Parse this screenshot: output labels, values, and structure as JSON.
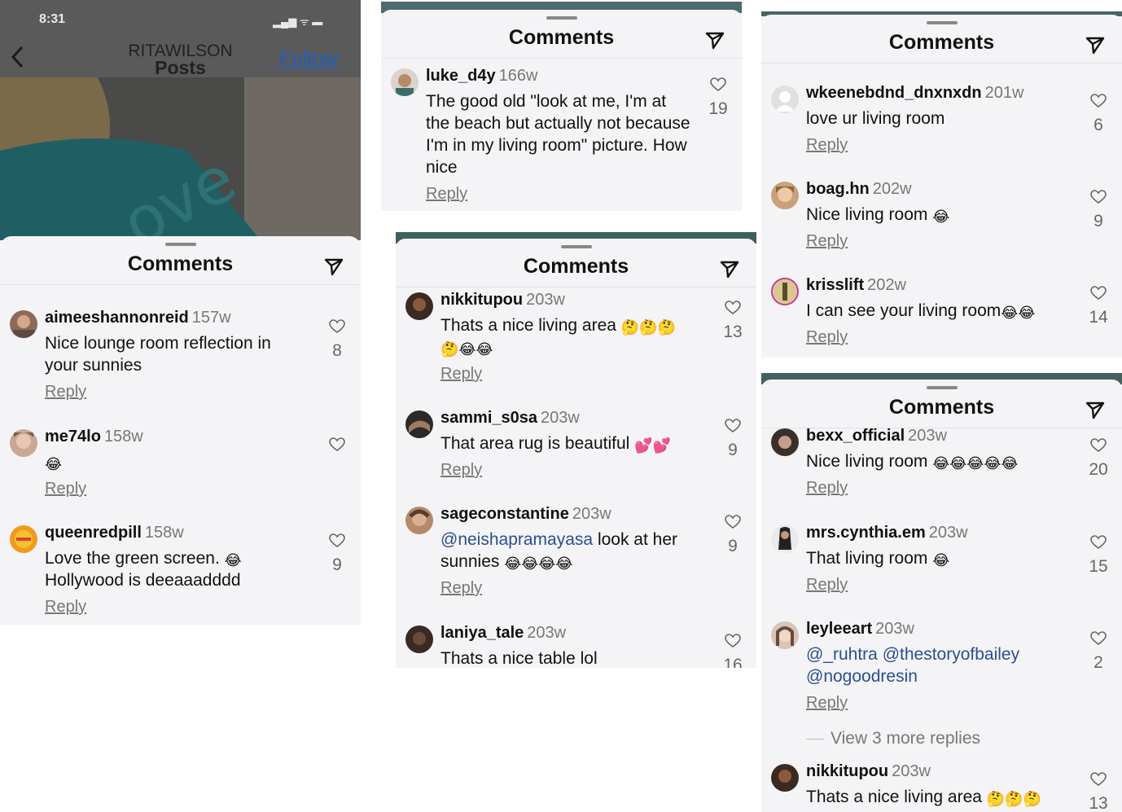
{
  "colors": {
    "mention": "#2a4f8f",
    "follow": "#1d5fbf",
    "sheet_bg": "#f4f4f6"
  },
  "panel1": {
    "status_time": "8:31",
    "account_name": "RITAWILSON",
    "page_title": "Posts",
    "follow_label": "Follow",
    "photo_text": "ove",
    "sheet_title": "Comments",
    "comments": [
      {
        "username": "aimeeshannonreid",
        "age": "157w",
        "text": "Nice lounge room reflection in your sunnies",
        "reply": "Reply",
        "likes": "8"
      },
      {
        "username": "me74lo",
        "age": "158w",
        "emoji": "😂",
        "reply": "Reply",
        "likes": ""
      },
      {
        "username": "queenredpill",
        "age": "158w",
        "text": "Love the green screen.",
        "emoji": "😂",
        "text2": "Hollywood is deeaaadddd",
        "reply": "Reply",
        "likes": "9"
      }
    ]
  },
  "panel2": {
    "sheet_title": "Comments",
    "comment": {
      "username": "luke_d4y",
      "age": "166w",
      "text": "The good old \"look at me, I'm at the beach but actually not because I'm in my living room\" picture. How nice",
      "reply": "Reply",
      "likes": "19"
    }
  },
  "panel3": {
    "sheet_title": "Comments",
    "comments": [
      {
        "username": "nikkitupou",
        "age": "203w",
        "text": "Thats a nice living area",
        "emoji": "🤔🤔🤔",
        "emoji2": "🤔😂😂",
        "reply": "Reply",
        "likes": "13"
      },
      {
        "username": "sammi_s0sa",
        "age": "203w",
        "text": "That area rug is beautiful",
        "emoji": "💕💕",
        "reply": "Reply",
        "likes": "9"
      },
      {
        "username": "sageconstantine",
        "age": "203w",
        "mention": "@neishapramayasa",
        "text": "look at her",
        "text2": "sunnies",
        "emoji": "😂😂😂😂",
        "reply": "Reply",
        "likes": "9"
      },
      {
        "username": "laniya_tale",
        "age": "203w",
        "text": "Thats a nice table lol",
        "likes": "16"
      }
    ]
  },
  "panel4": {
    "sheet_title": "Comments",
    "comments": [
      {
        "username": "wkeenebdnd_dnxnxdn",
        "age": "201w",
        "text": "love ur living room",
        "reply": "Reply",
        "likes": "6"
      },
      {
        "username": "boag.hn",
        "age": "202w",
        "text": "Nice living room",
        "emoji": "😂",
        "reply": "Reply",
        "likes": "9"
      },
      {
        "username": "krisslift",
        "age": "202w",
        "text": "I can see your living room",
        "emoji": "😂😂",
        "reply": "Reply",
        "likes": "14"
      }
    ]
  },
  "panel5": {
    "sheet_title": "Comments",
    "view_more": "View 3 more replies",
    "comments": [
      {
        "username": "bexx_official",
        "age": "203w",
        "text": "Nice living room",
        "emoji": "😂😂😂😂😂",
        "reply": "Reply",
        "likes": "20"
      },
      {
        "username": "mrs.cynthia.em",
        "age": "203w",
        "text": "That living room",
        "emoji": "😂",
        "reply": "Reply",
        "likes": "15"
      },
      {
        "username": "leyleeart",
        "age": "203w",
        "mention": "@_ruhtra @thestoryofbailey",
        "mention2": "@nogoodresin",
        "reply": "Reply",
        "likes": "2"
      },
      {
        "username": "nikkitupou",
        "age": "203w",
        "text": "Thats a nice living area",
        "emoji": "🤔🤔🤔",
        "likes": "13"
      }
    ]
  }
}
